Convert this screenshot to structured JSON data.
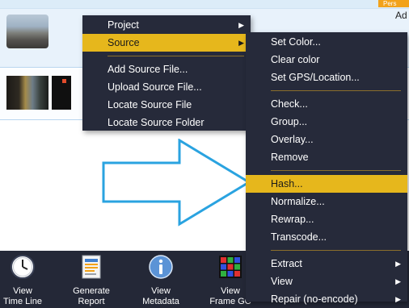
{
  "app": {
    "top_tab": "Pers",
    "top_right_label": "Ad"
  },
  "context_menu": {
    "items": [
      {
        "label": "Project",
        "has_submenu": true
      },
      {
        "label": "Source",
        "has_submenu": true,
        "highlighted": true
      },
      {
        "label": "Add Source File..."
      },
      {
        "label": "Upload Source File..."
      },
      {
        "label": "Locate Source File"
      },
      {
        "label": "Locate Source Folder"
      }
    ]
  },
  "source_submenu": {
    "items": [
      {
        "label": "Set Color..."
      },
      {
        "label": "Clear color"
      },
      {
        "label": "Set GPS/Location..."
      },
      {
        "label": "Check..."
      },
      {
        "label": "Group..."
      },
      {
        "label": "Overlay..."
      },
      {
        "label": "Remove"
      },
      {
        "label": "Hash...",
        "highlighted": true
      },
      {
        "label": "Normalize..."
      },
      {
        "label": "Rewrap..."
      },
      {
        "label": "Transcode..."
      },
      {
        "label": "Extract",
        "has_submenu": true
      },
      {
        "label": "View",
        "has_submenu": true
      },
      {
        "label": "Repair (no-encode)",
        "has_submenu": true
      }
    ]
  },
  "toolbar": {
    "buttons": [
      {
        "line1": "View",
        "line2": "Time Line",
        "icon": "clock-icon"
      },
      {
        "line1": "Generate",
        "line2": "Report",
        "icon": "report-icon"
      },
      {
        "line1": "View",
        "line2": "Metadata",
        "icon": "info-icon"
      },
      {
        "line1": "View",
        "line2": "Frame GC",
        "icon": "frame-grid-icon"
      }
    ]
  },
  "colors": {
    "menu_bg": "#262a3a",
    "highlight": "#e6b71c",
    "toolbar_bg": "#242837",
    "arrow_stroke": "#2aa3e0"
  }
}
